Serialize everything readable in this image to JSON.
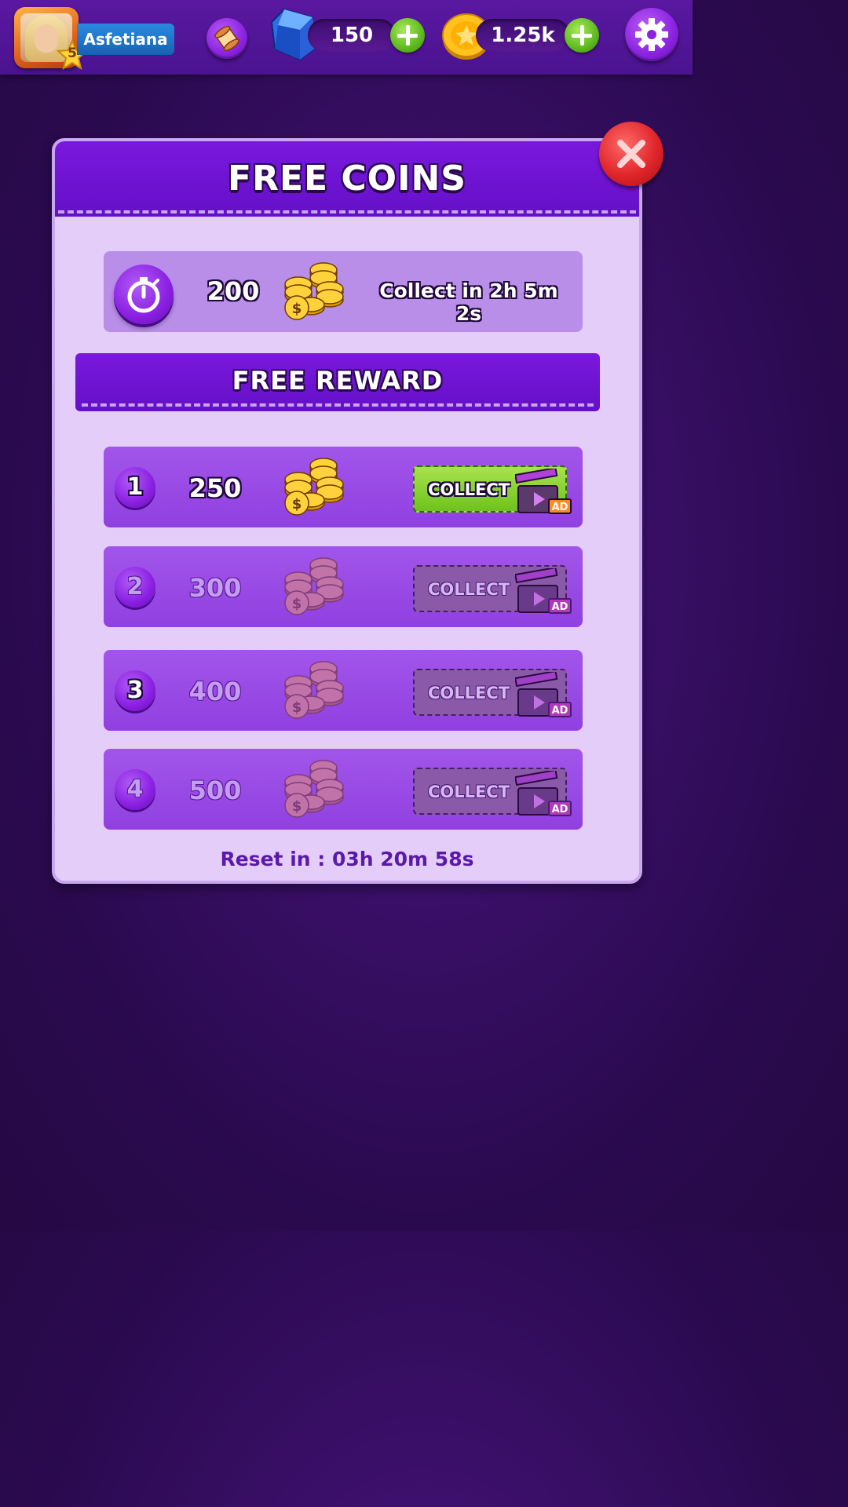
{
  "topbar": {
    "player_name": "Asfetiana",
    "level": "5",
    "gems": "150",
    "coins": "1.25k"
  },
  "dialog": {
    "title": "FREE COINS",
    "timer": {
      "amount": "200",
      "text": "Collect in 2h 5m 2s"
    },
    "reward_section_title": "FREE REWARD",
    "rewards": [
      {
        "index": "1",
        "amount": "250",
        "button_label": "COLLECT",
        "ad_label": "AD",
        "state": "active"
      },
      {
        "index": "2",
        "amount": "300",
        "button_label": "COLLECT",
        "ad_label": "AD",
        "state": "locked"
      },
      {
        "index": "3",
        "amount": "400",
        "button_label": "COLLECT",
        "ad_label": "AD",
        "state": "locked"
      },
      {
        "index": "4",
        "amount": "500",
        "button_label": "COLLECT",
        "ad_label": "AD",
        "state": "locked"
      }
    ],
    "reset_text": "Reset in : 03h 20m 58s"
  },
  "icons": {
    "avatar": "player-portrait",
    "level": "star-icon",
    "scroll": "scroll-icon",
    "gem": "blue-gem-icon",
    "coin": "gold-coin-icon",
    "add": "plus-icon",
    "settings": "gear-icon",
    "close": "close-icon",
    "timer": "stopwatch-icon",
    "coin_stack": "coin-stack-icon",
    "ad": "clapperboard-icon"
  },
  "colors": {
    "accent_purple": "#7a18dc",
    "collect_green": "#6fc21e",
    "close_red": "#e0262a"
  }
}
